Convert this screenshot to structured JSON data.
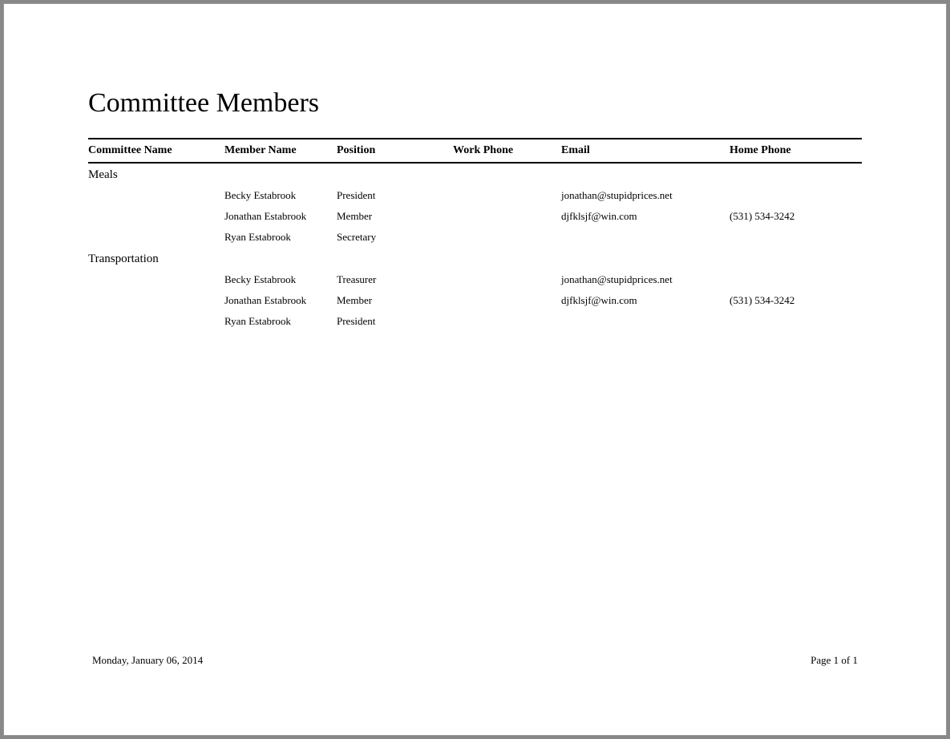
{
  "report": {
    "title": "Committee Members",
    "columns": {
      "committee": "Committee Name",
      "member": "Member Name",
      "position": "Position",
      "workphone": "Work Phone",
      "email": "Email",
      "homephone": "Home Phone"
    },
    "groups": [
      {
        "committee": "Meals",
        "members": [
          {
            "name": "Becky Estabrook",
            "position": "President",
            "workphone": "",
            "email": "jonathan@stupidprices.net",
            "homephone": ""
          },
          {
            "name": "Jonathan Estabrook",
            "position": "Member",
            "workphone": "",
            "email": "djfklsjf@win.com",
            "homephone": "(531) 534-3242"
          },
          {
            "name": "Ryan Estabrook",
            "position": "Secretary",
            "workphone": "",
            "email": "",
            "homephone": ""
          }
        ]
      },
      {
        "committee": "Transportation",
        "members": [
          {
            "name": "Becky Estabrook",
            "position": "Treasurer",
            "workphone": "",
            "email": "jonathan@stupidprices.net",
            "homephone": ""
          },
          {
            "name": "Jonathan Estabrook",
            "position": "Member",
            "workphone": "",
            "email": "djfklsjf@win.com",
            "homephone": "(531) 534-3242"
          },
          {
            "name": "Ryan Estabrook",
            "position": "President",
            "workphone": "",
            "email": "",
            "homephone": ""
          }
        ]
      }
    ],
    "footer": {
      "date": "Monday, January 06, 2014",
      "page": "Page 1 of 1"
    }
  }
}
